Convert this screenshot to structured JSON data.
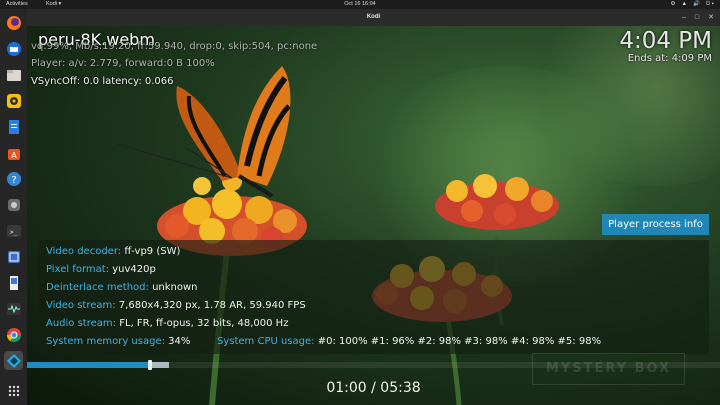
{
  "system_bar": {
    "activities": "Activities",
    "app_menu": "Kodi ▾",
    "clock": "Oct 16  16:04",
    "tray": [
      "⚙",
      "▲",
      "🔊",
      "⏻ ▾"
    ]
  },
  "window": {
    "title": "Kodi",
    "controls": [
      "–",
      "□",
      "✕"
    ]
  },
  "dock": {
    "apps": [
      {
        "name": "firefox",
        "glyph": "🦊"
      },
      {
        "name": "thunderbird",
        "glyph": "✉"
      },
      {
        "name": "files",
        "glyph": "📁"
      },
      {
        "name": "rhythmbox",
        "glyph": "◉"
      },
      {
        "name": "libreoffice-writer",
        "glyph": "📄"
      },
      {
        "name": "software",
        "glyph": "A"
      },
      {
        "name": "help",
        "glyph": "?"
      },
      {
        "name": "settings",
        "glyph": "⚙"
      },
      {
        "name": "terminal",
        "glyph": ">_"
      },
      {
        "name": "screenshot",
        "glyph": "▣"
      },
      {
        "name": "document",
        "glyph": "▯"
      },
      {
        "name": "system-monitor",
        "glyph": "∿"
      },
      {
        "name": "chrome",
        "glyph": "◎"
      },
      {
        "name": "kodi",
        "glyph": "✦"
      },
      {
        "name": "show-applications",
        "glyph": "⋮⋮⋮"
      }
    ]
  },
  "osd": {
    "file_title": "peru-8K.webm",
    "debug_line1": "vq:99%, Mb/s:19.20, fr:59.940, drop:0, skip:504, pc:none",
    "debug_line2": "Player: a/v: 2.779, forward:0 B 100%",
    "debug_line3": "VSyncOff: 0.0 latency: 0.066",
    "time": "4:04 PM",
    "ends_at": "Ends at: 4:09 PM"
  },
  "player_process_info_button": "Player process info",
  "info": {
    "video_decoder": {
      "label": "Video decoder:",
      "value": "ff-vp9 (SW)"
    },
    "pixel_format": {
      "label": "Pixel format:",
      "value": "yuv420p"
    },
    "deinterlace": {
      "label": "Deinterlace method:",
      "value": "unknown"
    },
    "video_stream": {
      "label": "Video stream:",
      "value": "7,680x4,320 px, 1.78 AR, 59.940 FPS"
    },
    "audio_stream": {
      "label": "Audio stream:",
      "value": "FL, FR, ff-opus, 32 bits, 48,000 Hz"
    },
    "memory": {
      "label": "System memory usage:",
      "value": "34%"
    },
    "cpu": {
      "label": "System CPU usage:",
      "value": "#0: 100% #1:  96% #2:  98% #3:  98% #4:  98% #5:  98%"
    }
  },
  "watermark": "MYSTERY BOX",
  "playback": {
    "current": "01:00",
    "total": "05:38",
    "readout": "01:00 / 05:38",
    "progress_fraction": 0.1775,
    "buffered_fraction": 0.205
  }
}
